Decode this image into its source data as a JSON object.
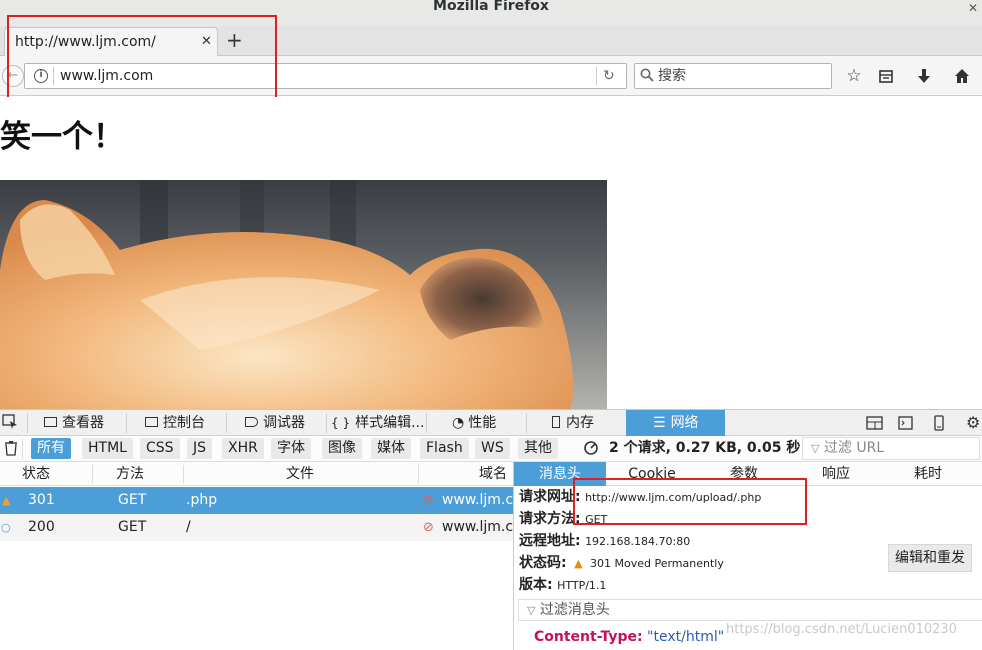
{
  "window": {
    "title": "Mozilla Firefox"
  },
  "tab": {
    "title": "http://www.ljm.com/"
  },
  "urlbar": {
    "url": "www.ljm.com"
  },
  "searchbar": {
    "placeholder": "搜索"
  },
  "page": {
    "heading": "笑一个！"
  },
  "devtools": {
    "tabs": [
      {
        "label": "查看器",
        "icon": "inspector-icon"
      },
      {
        "label": "控制台",
        "icon": "console-icon"
      },
      {
        "label": "调试器",
        "icon": "debugger-icon"
      },
      {
        "label": "样式编辑...",
        "icon": "style-editor-icon"
      },
      {
        "label": "性能",
        "icon": "performance-icon"
      },
      {
        "label": "内存",
        "icon": "memory-icon"
      },
      {
        "label": "网络",
        "icon": "network-icon"
      }
    ],
    "filters": [
      "所有",
      "HTML",
      "CSS",
      "JS",
      "XHR",
      "字体",
      "图像",
      "媒体",
      "Flash",
      "WS",
      "其他"
    ],
    "summary": "2 个请求, 0.27 KB, 0.05 秒",
    "url_filter_placeholder": "过滤 URL",
    "columns": [
      "状态",
      "方法",
      "文件",
      "域名"
    ],
    "requests": [
      {
        "status": "301",
        "method": "GET",
        "file": ".php",
        "domain": "www.ljm.com"
      },
      {
        "status": "200",
        "method": "GET",
        "file": "/",
        "domain": "www.ljm.com"
      }
    ],
    "detail_tabs": [
      "消息头",
      "Cookie",
      "参数",
      "响应",
      "耗时"
    ],
    "detail": {
      "request_url_label": "请求网址:",
      "request_url": "http://www.ljm.com/upload/.php",
      "method_label": "请求方法:",
      "method": "GET",
      "remote_label": "远程地址:",
      "remote": "192.168.184.70:80",
      "status_label": "状态码:",
      "status": "301 Moved Permanently",
      "version_label": "版本:",
      "version": "HTTP/1.1",
      "resend_label": "编辑和重发",
      "header_filter_placeholder": "过滤消息头",
      "content_type_key": "Content-Type:",
      "content_type_value": "\"text/html\""
    }
  },
  "watermark": "https://blog.csdn.net/Lucien010230",
  "colors": {
    "accent": "#4c9ed9",
    "annotation": "#e02020",
    "warning": "#e8870e"
  }
}
